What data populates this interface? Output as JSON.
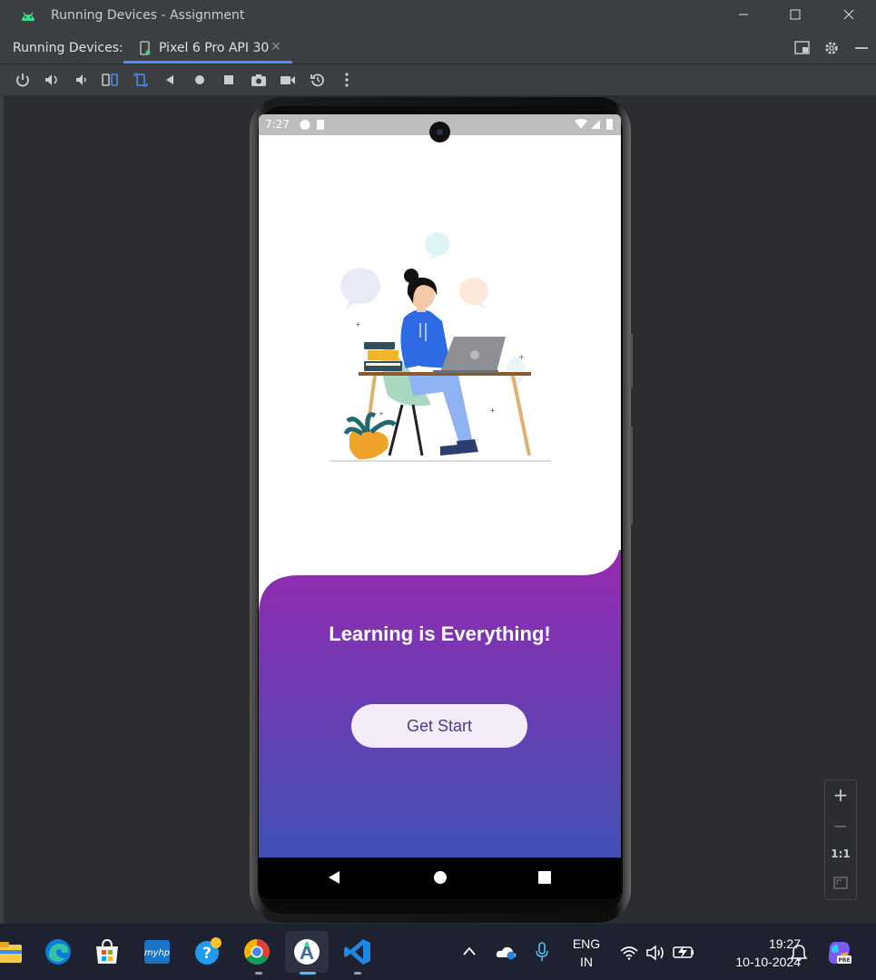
{
  "window": {
    "title": "Running Devices - Assignment",
    "controls": [
      "minimize",
      "maximize",
      "close"
    ]
  },
  "tabbar": {
    "label": "Running Devices:",
    "active_tab": {
      "name": "Pixel 6 Pro API 30",
      "icon": "phone-device-icon"
    },
    "right_icons": [
      "layout-icon",
      "gear-icon",
      "minimize-panel-icon"
    ]
  },
  "toolbar": {
    "buttons": [
      "power-icon",
      "volume-up-icon",
      "volume-down-icon",
      "rotate-left-icon",
      "rotate-right-icon",
      "back-icon",
      "home-icon",
      "overview-icon",
      "screenshot-icon",
      "screen-record-icon",
      "reset-icon",
      "more-options-icon"
    ]
  },
  "device": {
    "status_time": "7:27",
    "headline": "Learning is Everything!",
    "button_label": "Get Start",
    "gradient_top": "#9c27b0",
    "gradient_bottom": "#3f51b5"
  },
  "zoom": {
    "plus": "+",
    "minus": "−",
    "reset": "1:1"
  },
  "taskbar": {
    "apps": [
      "file-explorer-icon",
      "edge-icon",
      "store-icon",
      "myhp-icon",
      "help-icon",
      "chrome-icon",
      "android-studio-icon",
      "vscode-icon"
    ],
    "tray": {
      "language_top": "ENG",
      "language_bottom": "IN",
      "time": "19:27",
      "date": "10-10-2024"
    }
  }
}
